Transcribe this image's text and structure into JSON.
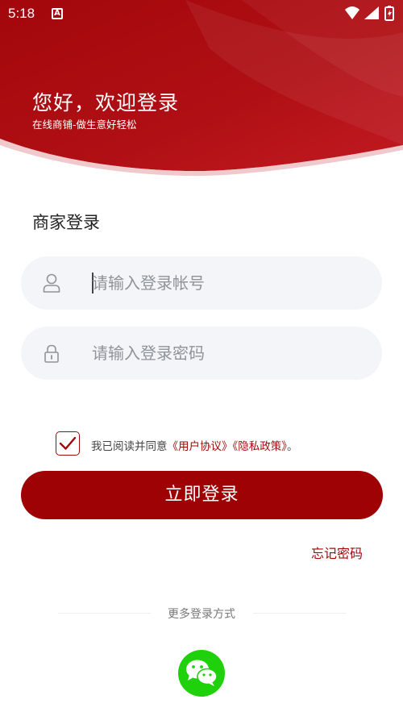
{
  "status_bar": {
    "time": "5:18",
    "app_indicator": "A",
    "icons": [
      "wifi-icon",
      "signal-icon",
      "battery-icon"
    ]
  },
  "header": {
    "greeting": "您好，欢迎登录",
    "subtitle": "在线商铺-做生意好轻松"
  },
  "login": {
    "section_title": "商家登录",
    "account_placeholder": "请输入登录帐号",
    "password_placeholder": "请输入登录密码",
    "agree_prefix": "我已阅读并同意",
    "user_agreement": "《用户协议》",
    "privacy_policy": "《隐私政策》",
    "agree_suffix": "。",
    "agreed": true,
    "submit_label": "立即登录",
    "forgot_label": "忘记密码"
  },
  "more_login": {
    "label": "更多登录方式",
    "options": [
      "wechat-icon"
    ]
  },
  "colors": {
    "brand_red": "#9e0205",
    "wechat_green": "#1ed10a",
    "input_bg": "#f3f5f8"
  }
}
